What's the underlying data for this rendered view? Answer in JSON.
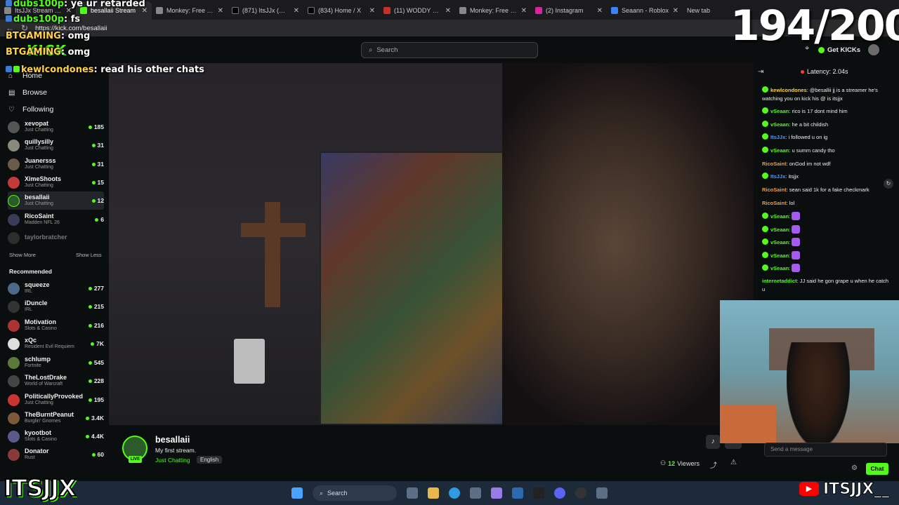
{
  "browser": {
    "tabs": [
      {
        "label": "ItsJJx Stream - Watch"
      },
      {
        "label": "besallaii Stream"
      },
      {
        "label": "Monkey: Free Live Vi"
      },
      {
        "label": "(871) ItsJJx (@ItsJJx_"
      },
      {
        "label": "(834) Home / X"
      },
      {
        "label": "(11) WODDY X MHA"
      },
      {
        "label": "Monkey: Free Live Vi"
      },
      {
        "label": "(2) Instagram"
      },
      {
        "label": "Seaann - Roblox"
      },
      {
        "label": "New tab"
      }
    ],
    "url": "https://kick.com/besallaii"
  },
  "header": {
    "logo": "KICK",
    "search_placeholder": "Search",
    "get_kicks": "Get KICKs"
  },
  "overlay": {
    "counter": "194/200",
    "chat": [
      {
        "user": "dubs100p",
        "text": "ye ur retarded"
      },
      {
        "user": "BTGAMING",
        "text": "omg"
      },
      {
        "user": "dubs100p",
        "text": "fs"
      },
      {
        "user": "BTGAMING",
        "text": "omg"
      },
      {
        "user": "kewlcondones",
        "text": "read his other chats"
      }
    ]
  },
  "sidebar": {
    "nav": [
      {
        "label": "Home"
      },
      {
        "label": "Browse"
      },
      {
        "label": "Following"
      }
    ],
    "following": [
      {
        "name": "xevopat",
        "game": "Just Chatting",
        "viewers": "185"
      },
      {
        "name": "quillysilly",
        "game": "Just Chatting",
        "viewers": "31"
      },
      {
        "name": "Juanersss",
        "game": "Just Chatting",
        "viewers": "31"
      },
      {
        "name": "XimeShoots",
        "game": "Just Chatting",
        "viewers": "15"
      },
      {
        "name": "besallaii",
        "game": "Just Chatting",
        "viewers": "12"
      },
      {
        "name": "RicoSaint",
        "game": "Madden NFL 26",
        "viewers": "6"
      },
      {
        "name": "taylorbratcher",
        "game": "",
        "viewers": ""
      }
    ],
    "show_more": "Show More",
    "show_less": "Show Less",
    "recommended_header": "Recommended",
    "recommended": [
      {
        "name": "squeeze",
        "game": "IRL",
        "viewers": "277"
      },
      {
        "name": "iDuncle",
        "game": "IRL",
        "viewers": "215"
      },
      {
        "name": "Motivation",
        "game": "Slots & Casino",
        "viewers": "216"
      },
      {
        "name": "xQc",
        "game": "Resident Evil Requiem",
        "viewers": "7K"
      },
      {
        "name": "schlump",
        "game": "Fortnite",
        "viewers": "545"
      },
      {
        "name": "TheLostDrake",
        "game": "World of Warcraft",
        "viewers": "228"
      },
      {
        "name": "PoliticallyProvoked",
        "game": "Just Chatting",
        "viewers": "195"
      },
      {
        "name": "TheBurntPeanut",
        "game": "Burglin' Gnomes",
        "viewers": "3.4K"
      },
      {
        "name": "kyootbot",
        "game": "Slots & Casino",
        "viewers": "4.4K"
      },
      {
        "name": "Donator",
        "game": "Rust",
        "viewers": "60"
      }
    ]
  },
  "stream": {
    "name": "besallaii",
    "title": "My first stream.",
    "category": "Just Chatting",
    "language": "English",
    "live": "LIVE",
    "viewers": "12",
    "viewers_label": "Viewers"
  },
  "chat": {
    "latency": "Latency: 2.04s",
    "messages": [
      {
        "user": "kewlcondones",
        "text": "@besallii jj is a streamer he's watching you on kick his @ is itsjjx"
      },
      {
        "user": "vSeaan",
        "text": "rico is 17 dont mind him"
      },
      {
        "user": "vSeaan",
        "text": "he a bit childish"
      },
      {
        "user": "ItsJJx",
        "text": "i followed u on ig"
      },
      {
        "user": "vSeaan",
        "text": "u summ candy tho"
      },
      {
        "user": "RicoSaint",
        "text": "onGod im not wdf"
      },
      {
        "user": "ItsJJx",
        "text": "itsjjx"
      },
      {
        "user": "RicoSaint",
        "text": "sean said 1k for a fake checkmark"
      },
      {
        "user": "RicoSaint",
        "text": "lol"
      },
      {
        "user": "vSeaan",
        "text": ""
      },
      {
        "user": "vSeaan",
        "text": ""
      },
      {
        "user": "vSeaan",
        "text": ""
      },
      {
        "user": "vSeaan",
        "text": ""
      },
      {
        "user": "vSeaan",
        "text": ""
      },
      {
        "user": "internetaddict",
        "text": "JJ said he gon grape u when he catch u"
      }
    ],
    "send_placeholder": "Send a message",
    "chat_button": "Chat"
  },
  "taskbar": {
    "search": "Search"
  },
  "stamps": {
    "left": "ITSJJX",
    "right": "ITSJJX__"
  },
  "colors": {
    "accent": "#53fc18",
    "background": "#0b0e0f"
  }
}
